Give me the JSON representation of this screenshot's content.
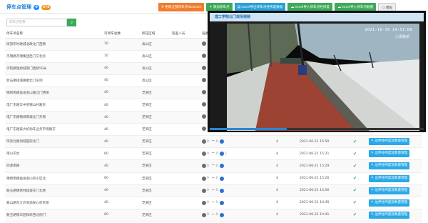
{
  "header": {
    "title": "停车点管理",
    "badge_a": "0",
    "badge_b": "376",
    "badge_a_color": "#1e90ff",
    "badge_b_color": "#f0961f"
  },
  "toolbar": {
    "update_label": "更新全部停车点librarian",
    "add_label": "添加停车点",
    "export_label": "excel导出停车点经纬度数据",
    "import_label": "excel导入停车点经纬度",
    "import_count_label": "excel导入停车点数量",
    "template_label": "模板"
  },
  "search": {
    "placeholder": "停车点名称"
  },
  "columns": [
    "停车点名称",
    "可停车总数",
    "所在区域",
    "巡查人员",
    "设备",
    "",
    "",
    "",
    ""
  ],
  "rows": [
    {
      "name": "硕顶布叶路城北政北门西侧",
      "cap": "10",
      "area": "高山区",
      "dev": false
    },
    {
      "name": "杰瑞路杰瑞集团西门交北点",
      "cap": "10",
      "area": "高山区",
      "dev": false
    },
    {
      "name": "学院路理想城南门西侧50米",
      "cap": "40",
      "area": "高山区",
      "dev": false
    },
    {
      "name": "新石路钱城路都北门东侧",
      "cap": "40",
      "area": "高山区",
      "dev": false
    },
    {
      "name": "锦绣南路益省会山路北门西侧",
      "cap": "40",
      "area": "芝罘区",
      "dev": false
    },
    {
      "name": "电厂东路华中资锦山村路东",
      "cap": "40",
      "area": "芝罘区",
      "dev": false
    },
    {
      "name": "电厂东路锦绣南城北门东侧",
      "cap": "40",
      "area": "芝罘区",
      "dev": false
    },
    {
      "name": "电厂东路森大机动车业务市场路东",
      "cap": "40",
      "area": "芝罘区",
      "dev": false
    },
    {
      "name": "琼亮北路洞城医院北门",
      "cap": "40",
      "area": "芝罘区",
      "dev": true,
      "a": "0",
      "b": "0",
      "c": "",
      "cnt": "4",
      "time": "2021-06-21 15:50"
    },
    {
      "name": "南山学台",
      "cap": "60",
      "area": "芝罘区",
      "dev": true,
      "a": "0",
      "b": "0",
      "c": "1",
      "cnt": "4",
      "time": "2021-06-21 15:31"
    },
    {
      "name": "同源南路",
      "cap": "40",
      "area": "芝罘区",
      "dev": true,
      "a": "0",
      "b": "0",
      "c": "",
      "cnt": "4",
      "time": "2021-06-21 15:29"
    },
    {
      "name": "锦绣南路益省会山舆小区北",
      "cap": "60",
      "area": "芝罘区",
      "dev": true,
      "a": "0",
      "b": "0",
      "c": "",
      "cnt": "4",
      "time": "2021-06-21 15:26"
    },
    {
      "name": "魁玉路锦绣林超城东门北侧",
      "cap": "40",
      "area": "芝罘区",
      "dev": true,
      "a": "0",
      "b": "0",
      "c": "",
      "cnt": "4",
      "time": "2021-06-21 14:56"
    },
    {
      "name": "魁山路东大外资源安心校东侧",
      "cap": "40",
      "area": "芝罘区",
      "dev": true,
      "a": "0",
      "b": "0",
      "c": "",
      "cnt": "4",
      "time": "2021-06-21 14:45"
    },
    {
      "name": "魁玉路锦华园和商西北侧门",
      "cap": "60",
      "area": "芝罘区",
      "dev": true,
      "a": "0",
      "b": "0",
      "c": "",
      "cnt": "4",
      "time": "2021-06-21 14:41"
    }
  ],
  "edit_label": "边界经纬度及数量管理",
  "video": {
    "title": "理工学院北门现场视频",
    "timestamp": "2021-10-19 14:51:00",
    "caption": "小清枝桥",
    "progress": 0.36,
    "accent": "#2c86d1"
  },
  "colors": {
    "update": "#f07c2e",
    "add": "#3caa5a",
    "export": "#29a0d8",
    "import": "#3caa5a",
    "import_count": "#3caa5a"
  }
}
